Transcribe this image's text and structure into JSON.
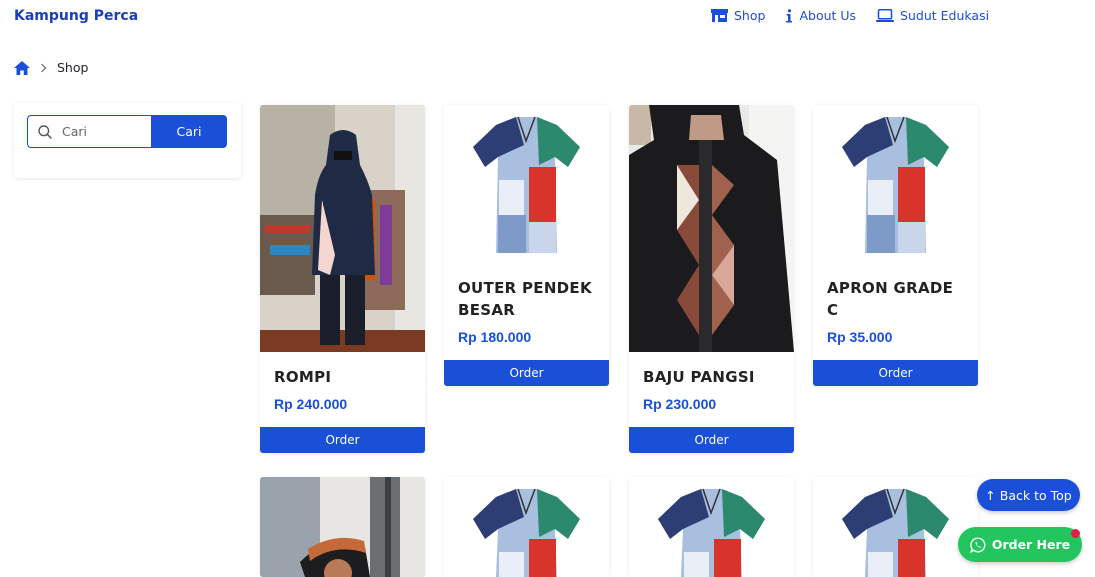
{
  "brand": "Kampung Perca",
  "nav": [
    {
      "label": "Shop",
      "icon": "store-icon"
    },
    {
      "label": "About Us",
      "icon": "info-icon"
    },
    {
      "label": "Sudut Edukasi",
      "icon": "laptop-icon"
    }
  ],
  "breadcrumb": {
    "current": "Shop"
  },
  "search": {
    "placeholder": "Cari",
    "button_label": "Cari"
  },
  "products": [
    {
      "name": "ROMPI",
      "price": "Rp 240.000",
      "order_label": "Order"
    },
    {
      "name": "OUTER PENDEK BESAR",
      "price": "Rp 180.000",
      "order_label": "Order"
    },
    {
      "name": "BAJU PANGSI",
      "price": "Rp 230.000",
      "order_label": "Order"
    },
    {
      "name": "APRON GRADE C",
      "price": "Rp 35.000",
      "order_label": "Order"
    }
  ],
  "floating": {
    "back_to_top": "↑ Back to Top",
    "order_here": "Order Here"
  },
  "colors": {
    "primary": "#1a4fd8",
    "brand_text": "#1a3fb8",
    "whatsapp": "#22c55e"
  }
}
